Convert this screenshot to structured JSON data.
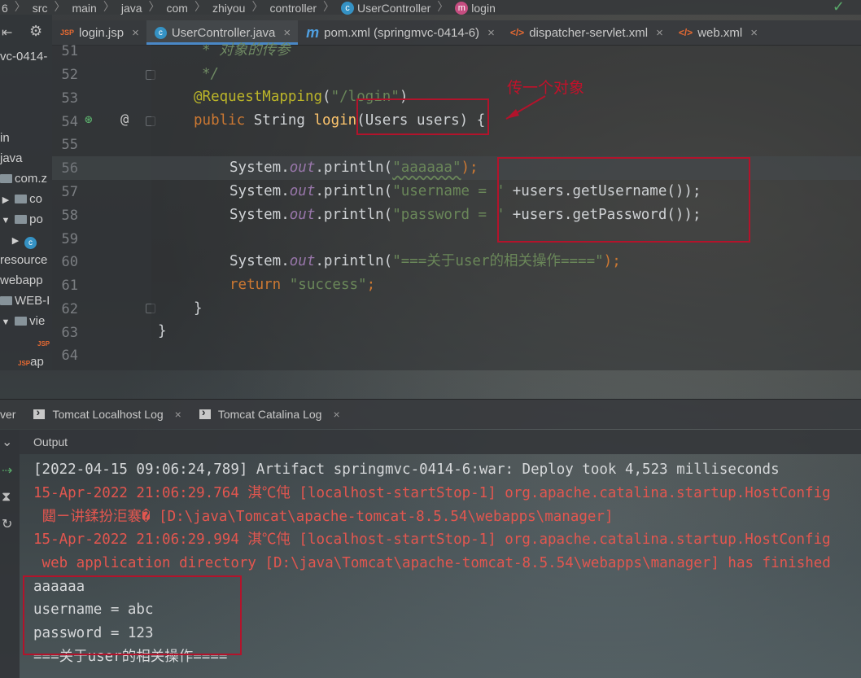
{
  "breadcrumb": {
    "items": [
      "6",
      "src",
      "main",
      "java",
      "com",
      "zhiyou",
      "controller",
      "UserController",
      "login"
    ]
  },
  "project": {
    "title_fragment": "vc-0414-",
    "items": [
      "in",
      "java",
      "com.z",
      "co",
      "po",
      "resource",
      "webapp",
      "WEB-I",
      "vie",
      "ap"
    ]
  },
  "tabs": [
    {
      "label": "login.jsp",
      "icon": "jsp-file-icon"
    },
    {
      "label": "UserController.java",
      "icon": "class-icon",
      "active": true
    },
    {
      "label": "pom.xml (springmvc-0414-6)",
      "icon": "maven-icon"
    },
    {
      "label": "dispatcher-servlet.xml",
      "icon": "xml-file-icon"
    },
    {
      "label": "web.xml",
      "icon": "xml-file-icon"
    }
  ],
  "editor": {
    "line_numbers": [
      "51",
      "52",
      "53",
      "54",
      "55",
      "56",
      "57",
      "58",
      "59",
      "60",
      "61",
      "62",
      "63",
      "64"
    ],
    "current_line": "56",
    "lines": {
      "l51": "* 对象的传参",
      "l52": "*/",
      "l53_ann": "@RequestMapping",
      "l53_paren_open": "(",
      "l53_str": "\"/login\"",
      "l53_paren_close": ")",
      "l54_kw": "public",
      "l54_type": " String ",
      "l54_fn": "login",
      "l54_params": "(Users users) {",
      "l56_pre": "System.",
      "l56_out": "out",
      "l56_mid": ".println(",
      "l56_str": "\"aaaaaa\"",
      "l56_end": ");",
      "l57_pre": "System.",
      "l57_out": "out",
      "l57_mid": ".println(",
      "l57_str": "\"username = \"",
      "l57_end": " +users.getUsername());",
      "l58_pre": "System.",
      "l58_out": "out",
      "l58_mid": ".println(",
      "l58_str": "\"password = \"",
      "l58_end": " +users.getPassword());",
      "l60_pre": "System.",
      "l60_out": "out",
      "l60_mid": ".println(",
      "l60_str": "\"===关于user的相关操作====\"",
      "l60_end": ");",
      "l61_kw": "return",
      "l61_str": " \"success\"",
      "l61_end": ";",
      "l62": "}",
      "l63": "}"
    },
    "annotation_text": "传一个对象",
    "colors": {
      "annotation_red": "#b3132b",
      "keyword": "#cc7832",
      "string": "#6a8759",
      "annotation": "#bbb529",
      "field": "#9876aa",
      "method": "#ffc66d"
    }
  },
  "bottom_panel": {
    "tabs": [
      {
        "label": "ver"
      },
      {
        "label": "Tomcat Localhost Log"
      },
      {
        "label": "Tomcat Catalina Log"
      }
    ],
    "output_label": "Output",
    "console_lines": [
      {
        "text": "[2022-04-15 09:06:24,789] Artifact springmvc-0414-6:war: Deploy took 4,523 milliseconds",
        "style": "normal"
      },
      {
        "text": "15-Apr-2022 21:06:29.764 淇℃伅 [localhost-startStop-1] org.apache.catalina.startup.HostConfig",
        "style": "red"
      },
      {
        "text": " 閮ㄧ讲鍒扮洰褰� [D:\\java\\Tomcat\\apache-tomcat-8.5.54\\webapps\\manager]",
        "style": "red"
      },
      {
        "text": "15-Apr-2022 21:06:29.994 淇℃伅 [localhost-startStop-1] org.apache.catalina.startup.HostConfig",
        "style": "red"
      },
      {
        "text": " web application directory [D:\\java\\Tomcat\\apache-tomcat-8.5.54\\webapps\\manager] has finished",
        "style": "red"
      },
      {
        "text": "aaaaaa",
        "style": "normal"
      },
      {
        "text": "username = abc",
        "style": "normal"
      },
      {
        "text": "password = 123",
        "style": "normal"
      },
      {
        "text": "===关于user的相关操作====",
        "style": "normal"
      }
    ]
  }
}
